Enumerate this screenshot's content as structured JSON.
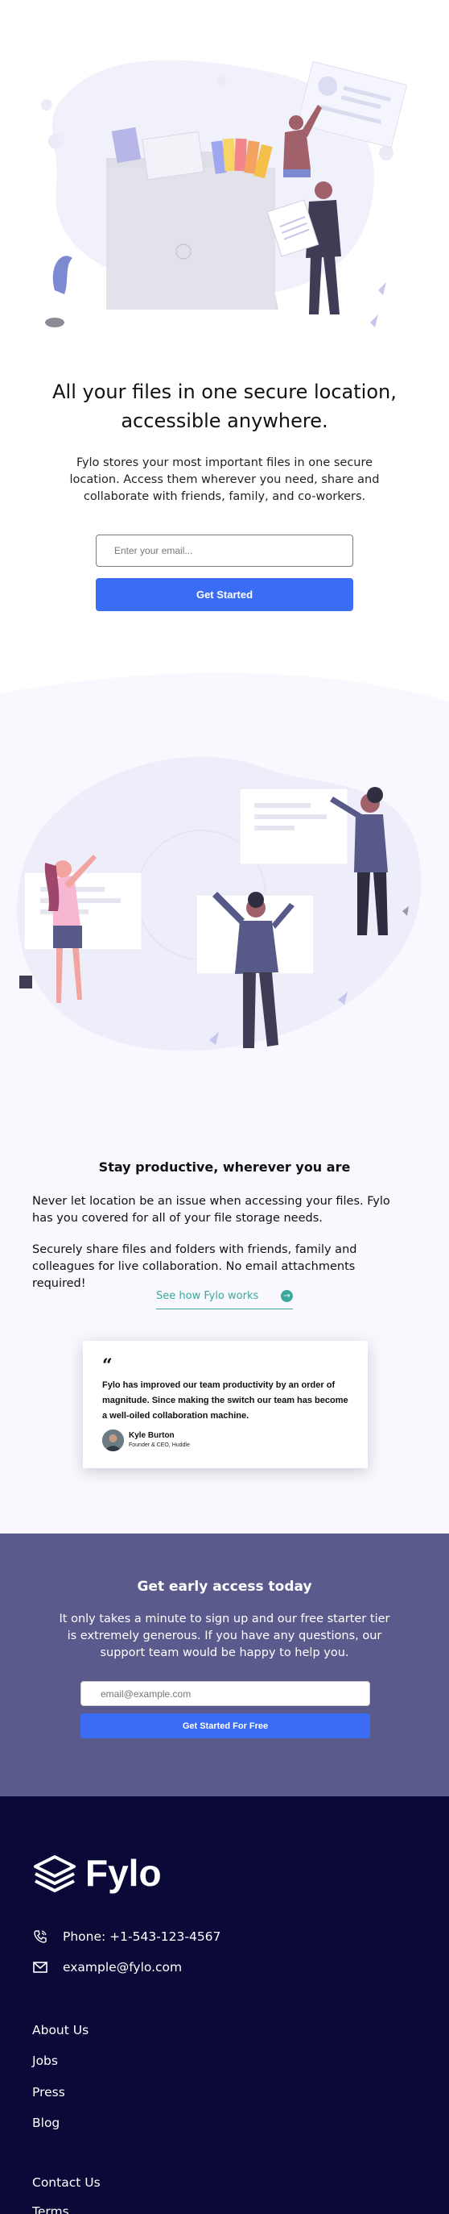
{
  "hero": {
    "title": "All your files in one secure location, accessible anywhere.",
    "text": "Fylo stores your most important files in one secure location. Access them wherever you need, share and collaborate with friends, family, and co-workers.",
    "email_placeholder": "Enter your email...",
    "cta_label": "Get Started"
  },
  "productive": {
    "title": "Stay productive, wherever you are",
    "paragraph_1": "Never let location be an issue when accessing your files. Fylo has you covered for all of your file storage needs.",
    "paragraph_2": "Securely share files and folders with friends, family and colleagues for live collaboration. No email attachments required!",
    "link_label": "See how Fylo works",
    "link_arrow": "→"
  },
  "testimonial": {
    "quote_mark": "“",
    "quote": "Fylo has improved our team productivity by an order of magnitude. Since making the switch our team has become a well-oiled collaboration machine.",
    "author_name": "Kyle Burton",
    "author_title": "Founder & CEO, Huddle"
  },
  "early_access": {
    "title": "Get early access today",
    "text": "It only takes a minute to sign up and our free starter tier is extremely generous. If you have any questions, our support team would be happy to help you.",
    "email_placeholder": "email@example.com",
    "cta_label": "Get Started For Free"
  },
  "footer": {
    "logo_text": "Fylo",
    "phone": "Phone: +1-543-123-4567",
    "email": "example@fylo.com",
    "links_1": [
      "About Us",
      "Jobs",
      "Press",
      "Blog"
    ],
    "links_2": [
      "Contact Us",
      "Terms"
    ]
  },
  "colors": {
    "accent_blue": "#3a6cf4",
    "link_teal": "#3aa99b",
    "early_access_bg": "#5b5a8d",
    "footer_bg": "#0b0938",
    "productive_bg": "#f8f8fe"
  },
  "icons": [
    "phone-icon",
    "email-icon",
    "fylo-logo-icon",
    "arrow-right-icon",
    "quote-icon"
  ]
}
